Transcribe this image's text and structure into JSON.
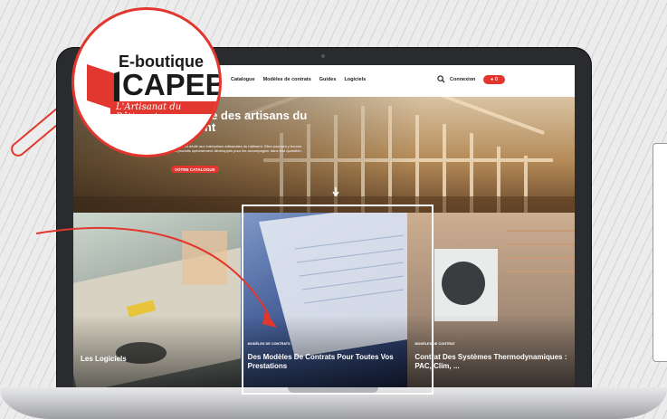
{
  "site": {
    "nav": [
      "Catalogue",
      "Modèles de contrats",
      "Guides",
      "Logiciels"
    ],
    "connexion": "Connexion",
    "cart_count": "0"
  },
  "hero": {
    "title": "Boutique des artisans du bâtiment",
    "description": "Ce site est dédié aux entreprises artisanales du bâtiment. Elles pourront y trouver des produits spécialement développés pour les accompagner dans leur quotidien.",
    "button": "VOTRE CATALOGUE"
  },
  "cards": [
    {
      "kicker": "",
      "title": "Les Logiciels"
    },
    {
      "kicker": "MODÈLES DE CONTRATS",
      "title": "Des Modèles De Contrats Pour Toutes Vos Prestations"
    },
    {
      "kicker": "MODÈLES DE CONTRAT",
      "title": "Contrat Des Systèmes Thermodynamiques : PAC, Clim, ..."
    }
  ],
  "logo": {
    "line1": "E-boutique",
    "line2": "CAPEB",
    "tagline": "L'Artisanat du Bâtiment"
  },
  "colors": {
    "accent": "#e2372e"
  }
}
